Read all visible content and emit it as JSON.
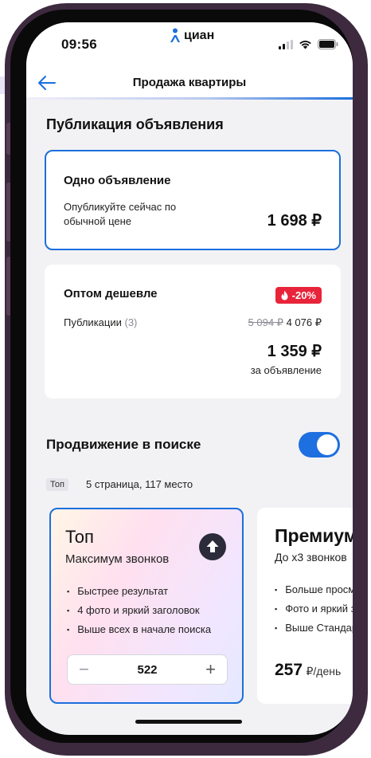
{
  "status_bar": {
    "time": "09:56",
    "brand": "циан"
  },
  "nav": {
    "title": "Продажа квартиры"
  },
  "publication": {
    "section_title": "Публикация объявления",
    "single": {
      "title": "Одно объявление",
      "description_line1": "Опубликуйте сейчас по",
      "description_line2": "обычной цене",
      "price": "1 698 ₽"
    },
    "bulk": {
      "title": "Оптом дешевле",
      "badge": "-20%",
      "publications_label": "Публикации",
      "publications_count": "(3)",
      "old_price": "5 094 ₽",
      "new_total": "4 076 ₽",
      "price": "1 359 ₽",
      "price_unit": "за объявление"
    }
  },
  "promotion": {
    "section_title": "Продвижение в поиске",
    "toggle_on": true,
    "chip": "Топ",
    "position_text": "5 страница, 117 место",
    "top_card": {
      "title": "Топ",
      "subtitle": "Максимум звонков",
      "features": [
        "Быстрее результат",
        "4 фото и яркий заголовок",
        "Выше всех в начале поиска"
      ],
      "stepper_value": "522",
      "minus": "−",
      "plus": "+"
    },
    "premium_card": {
      "title": "Премиум",
      "subtitle": "До x3 звонков",
      "features": [
        "Больше просмотров",
        "Фото и яркий заголовок",
        "Выше Стандарта"
      ],
      "price": "257",
      "price_unit": "₽/день"
    }
  },
  "colors": {
    "accent": "#1c6fdd",
    "badge": "#e8243a",
    "frame": "#3d2a3f"
  }
}
